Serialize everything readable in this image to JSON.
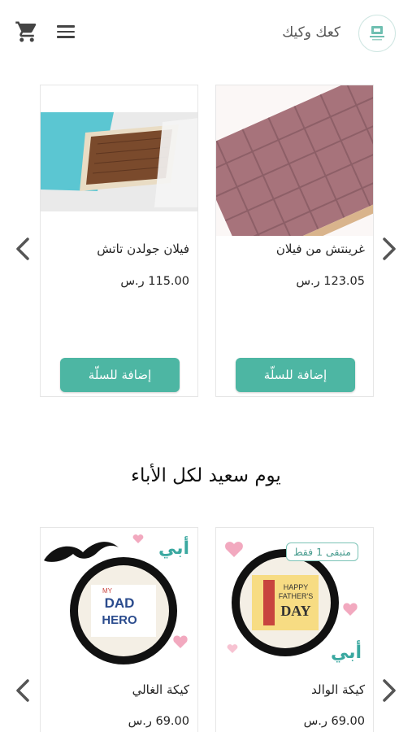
{
  "header": {
    "brand": "كعك وكيك",
    "icons": {
      "cart": "shopping-cart-icon",
      "menu": "hamburger-menu-icon",
      "logo": "brand-logo"
    }
  },
  "colors": {
    "accent": "#4db6a3",
    "badge_text": "#4a9d90",
    "price_text": "#222222"
  },
  "carousel1": {
    "products": [
      {
        "name": "غرينتش من فيلان",
        "price": "123.05 ر.س",
        "button": "إضافة للسلّة",
        "image": "chocolate-squares"
      },
      {
        "name": "فيلان جولدن تاتش",
        "price": "115.00 ر.س",
        "button": "إضافة للسلّة",
        "image": "chocolate-box"
      }
    ]
  },
  "section": {
    "title": "يوم سعيد لكل الأباء"
  },
  "carousel2": {
    "products": [
      {
        "name": "كيكة الوالد",
        "price": "69.00 ر.س",
        "badge": "متبقى 1 فقط",
        "image_word": "أبي",
        "cake_text_1": "HAPPY",
        "cake_text_2": "FATHER'S",
        "cake_text_3": "DAY"
      },
      {
        "name": "كيكة الغالي",
        "price": "69.00 ر.س",
        "image_word": "أبي",
        "cake_text_1": "DAD",
        "cake_text_2": "HERO",
        "cake_text_3": "MY"
      }
    ]
  }
}
